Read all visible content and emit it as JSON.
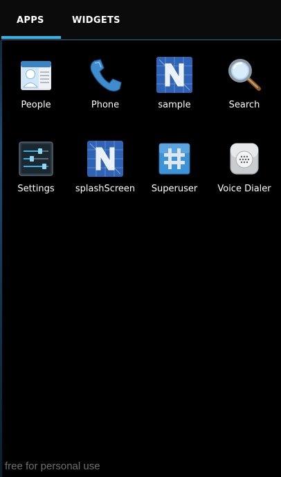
{
  "tabs": {
    "apps": "APPS",
    "widgets": "WIDGETS"
  },
  "apps": [
    {
      "label": "People",
      "icon": "people-icon"
    },
    {
      "label": "Phone",
      "icon": "phone-icon"
    },
    {
      "label": "sample",
      "icon": "n-logo-icon"
    },
    {
      "label": "Search",
      "icon": "magnifier-icon"
    },
    {
      "label": "Settings",
      "icon": "sliders-icon"
    },
    {
      "label": "splashScreen",
      "icon": "n-logo-icon"
    },
    {
      "label": "Superuser",
      "icon": "hash-icon"
    },
    {
      "label": "Voice Dialer",
      "icon": "speaker-icon"
    }
  ],
  "watermark": "free for personal use",
  "colors": {
    "accent": "#33b5e5",
    "background": "#000000"
  }
}
